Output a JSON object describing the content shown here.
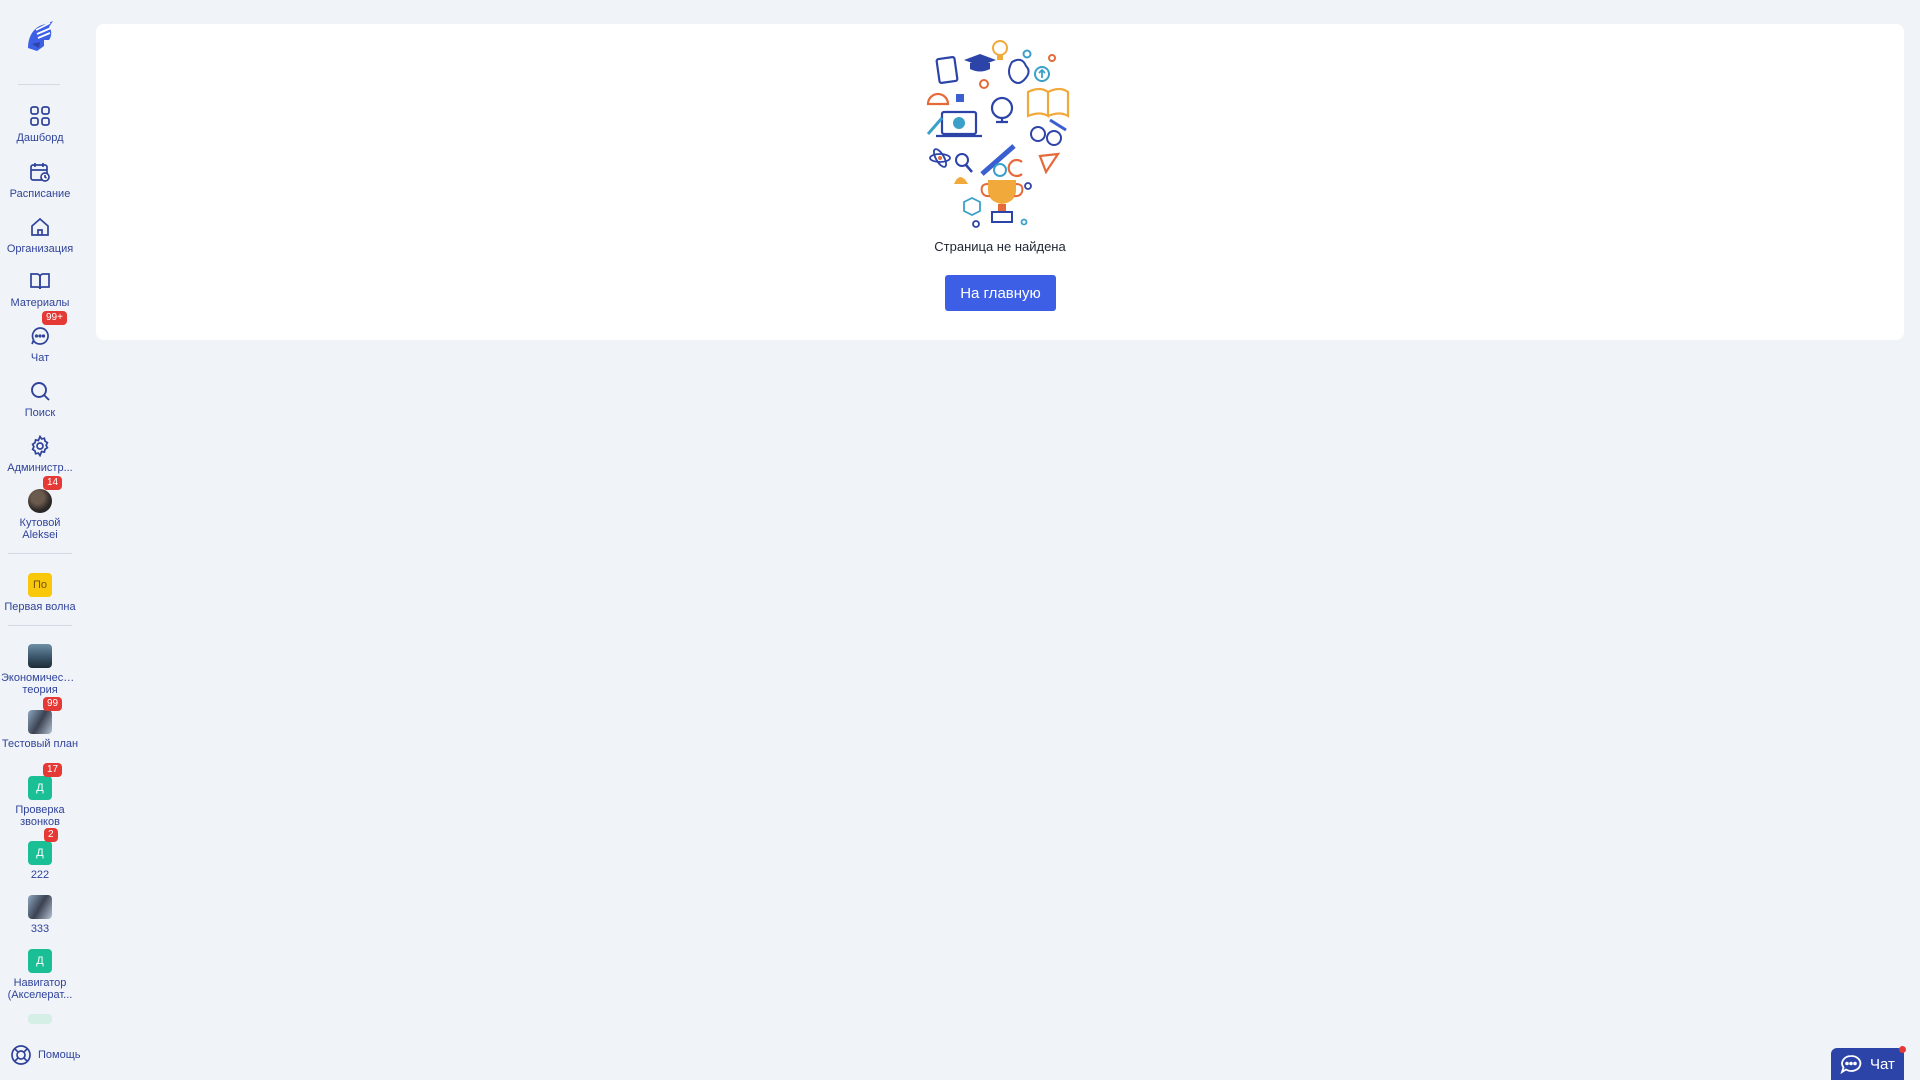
{
  "sidebar": {
    "nav": [
      {
        "label": "Дашборд",
        "icon": "dashboard-grid-icon"
      },
      {
        "label": "Расписание",
        "icon": "calendar-icon"
      },
      {
        "label": "Организация",
        "icon": "home-icon"
      },
      {
        "label": "Материалы",
        "icon": "book-icon"
      },
      {
        "label": "Чат",
        "icon": "chat-bubble-icon",
        "badge": "99+"
      },
      {
        "label": "Поиск",
        "icon": "search-icon"
      },
      {
        "label": "Администр...",
        "icon": "gear-icon"
      }
    ],
    "profile": {
      "label": "Кутовой Aleksei",
      "badge": "14"
    },
    "workspace": {
      "label": "Первая волна",
      "initials": "По"
    },
    "courses": [
      {
        "label": "Экономическая теория"
      },
      {
        "label": "Тестовый план",
        "badge": "99"
      },
      {
        "label": "Проверка звонков",
        "initials": "Д",
        "badge": "17"
      },
      {
        "label": "222",
        "initials": "Д",
        "badge": "2"
      },
      {
        "label": "333"
      },
      {
        "label": "Навигатор (Акселерат...",
        "initials": "Д"
      }
    ],
    "help_label": "Помощь"
  },
  "main": {
    "not_found_text": "Страница не найдена",
    "home_button_label": "На главную"
  },
  "chat_widget": {
    "label": "Чат"
  },
  "colors": {
    "accent": "#3c5fe6",
    "nav_text": "#30439a",
    "badge": "#e53935",
    "background": "#f0f4f8"
  }
}
